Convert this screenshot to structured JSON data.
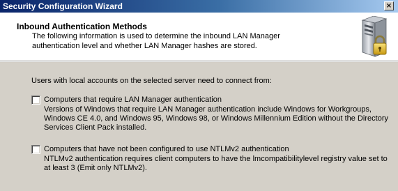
{
  "window": {
    "title": "Security Configuration Wizard",
    "close_glyph": "×"
  },
  "header": {
    "title": "Inbound Authentication Methods",
    "description": "The following information is used to determine the inbound LAN Manager authentication level and whether LAN Manager hashes are stored.",
    "icon": "server-lock-icon"
  },
  "main": {
    "intro": "Users with local accounts on the selected server need to connect from:",
    "options": [
      {
        "label": "Computers that require LAN Manager authentication",
        "description": "Versions of Windows that require LAN Manager authentication include Windows for Workgroups, Windows CE 4.0, and Windows 95, Windows 98, or Windows Millennium Edition without the Directory Services Client Pack installed.",
        "checked": false
      },
      {
        "label": "Computers that have not been configured to use NTLMv2 authentication",
        "description": "NTLMv2 authentication requires client computers to have the lmcompatibilitylevel registry value set to at least 3 (Emit only NTLMv2).",
        "checked": false
      }
    ]
  },
  "colors": {
    "titlebar_start": "#0a246a",
    "titlebar_end": "#a6caf0",
    "dialog_bg": "#d4d0c8",
    "header_bg": "#ffffff"
  }
}
